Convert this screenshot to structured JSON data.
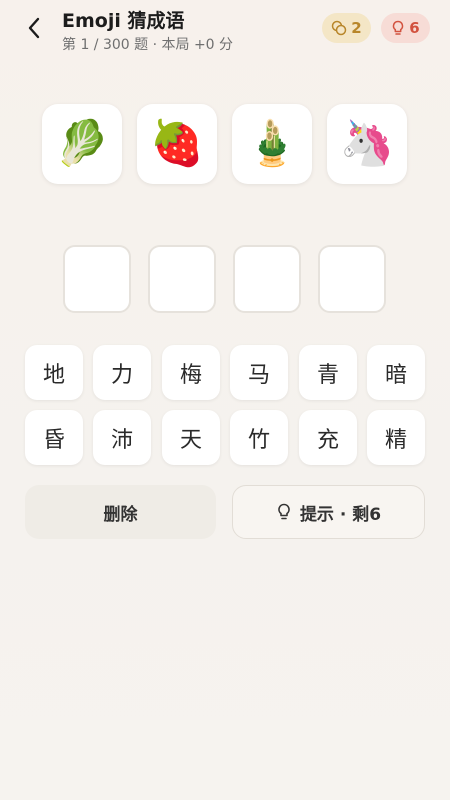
{
  "header": {
    "title": "Emoji 猜成语",
    "subtitle": "第 1 / 300 题 · 本局 +0 分",
    "coins": "2",
    "hints": "6"
  },
  "clues": [
    "🥬",
    "🍓",
    "🎍",
    "🦄"
  ],
  "answer_slots": [
    "",
    "",
    "",
    ""
  ],
  "characters": [
    [
      "地",
      "力",
      "梅",
      "马",
      "青",
      "暗"
    ],
    [
      "昏",
      "沛",
      "天",
      "竹",
      "充",
      "精"
    ]
  ],
  "actions": {
    "delete_label": "删除",
    "hint_label": "提示 · 剩6"
  }
}
